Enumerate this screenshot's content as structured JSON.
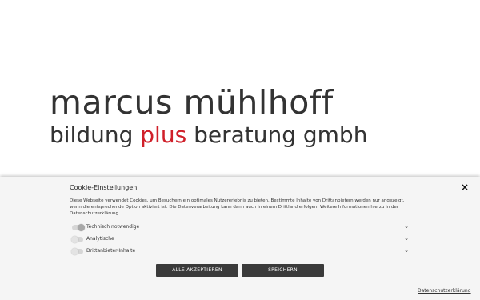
{
  "logo": {
    "line1": "marcus mühlhoff",
    "line2_pre": "bildung ",
    "line2_accent": "plus",
    "line2_post": " beratung gmbh"
  },
  "cookie": {
    "title": "Cookie-Einstellungen",
    "close_icon": "×",
    "description": "Diese Webseite verwendet Cookies, um Besuchern ein optimales Nutzererlebnis zu bieten. Bestimmte Inhalte von Drittanbietern werden nur angezeigt, wenn die entsprechende Option aktiviert ist. Die Datenverarbeitung kann dann auch in einem Drittland erfolgen. Weitere Informationen hierzu in der Datenschutzerklärung.",
    "categories": [
      {
        "label": "Technisch notwendige",
        "enabled": true
      },
      {
        "label": "Analytische",
        "enabled": false
      },
      {
        "label": "Drittanbieter-Inhalte",
        "enabled": false
      }
    ],
    "chevron": "⌄",
    "accept_all_label": "ALLE AKZEPTIEREN",
    "save_label": "SPEICHERN",
    "privacy_link": "Datenschutzerklärung"
  },
  "colors": {
    "accent": "#d0202a",
    "button_bg": "#3a3a3a",
    "panel_bg": "#f5f5f5"
  }
}
